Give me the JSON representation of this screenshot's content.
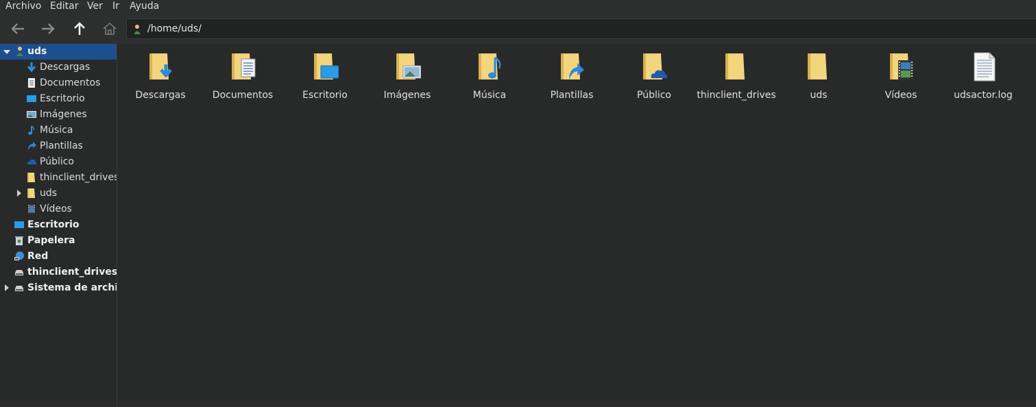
{
  "menubar": {
    "items": [
      "Archivo",
      "Editar",
      "Ver",
      "Ir",
      "Ayuda"
    ]
  },
  "toolbar": {
    "back_icon": "arrow-left-icon",
    "forward_icon": "arrow-right-icon",
    "up_icon": "arrow-up-icon",
    "home_icon": "home-icon",
    "address": "/home/uds/"
  },
  "sidebar": {
    "items": [
      {
        "label": "uds",
        "icon": "user-home-icon"
      },
      {
        "label": "Descargas",
        "icon": "download-icon"
      },
      {
        "label": "Documentos",
        "icon": "document-icon"
      },
      {
        "label": "Escritorio",
        "icon": "desktop-icon"
      },
      {
        "label": "Imágenes",
        "icon": "image-icon"
      },
      {
        "label": "Música",
        "icon": "music-icon"
      },
      {
        "label": "Plantillas",
        "icon": "template-icon"
      },
      {
        "label": "Público",
        "icon": "cloud-icon"
      },
      {
        "label": "thinclient_drives",
        "icon": "folder-icon"
      },
      {
        "label": "uds",
        "icon": "folder-icon"
      },
      {
        "label": "Vídeos",
        "icon": "video-icon"
      },
      {
        "label": "Escritorio",
        "icon": "desktop-icon"
      },
      {
        "label": "Papelera",
        "icon": "trash-icon"
      },
      {
        "label": "Red",
        "icon": "network-icon"
      },
      {
        "label": "thinclient_drives",
        "icon": "drive-icon"
      },
      {
        "label": "Sistema de archi",
        "icon": "drive-icon"
      }
    ]
  },
  "files": [
    {
      "name": "Descargas",
      "icon": "folder-download-icon"
    },
    {
      "name": "Documentos",
      "icon": "folder-documents-icon"
    },
    {
      "name": "Escritorio",
      "icon": "folder-desktop-icon"
    },
    {
      "name": "Imágenes",
      "icon": "folder-pictures-icon"
    },
    {
      "name": "Música",
      "icon": "folder-music-icon"
    },
    {
      "name": "Plantillas",
      "icon": "folder-templates-icon"
    },
    {
      "name": "Público",
      "icon": "folder-public-icon"
    },
    {
      "name": "thinclient_drives",
      "icon": "folder-icon"
    },
    {
      "name": "uds",
      "icon": "folder-icon"
    },
    {
      "name": "Vídeos",
      "icon": "folder-videos-icon"
    },
    {
      "name": "udsactor.log",
      "icon": "text-file-icon"
    }
  ],
  "colors": {
    "background": "#282a2a",
    "selection": "#1d4f8f",
    "folder": "#f3d57e",
    "accent_blue": "#2f8ad9"
  }
}
